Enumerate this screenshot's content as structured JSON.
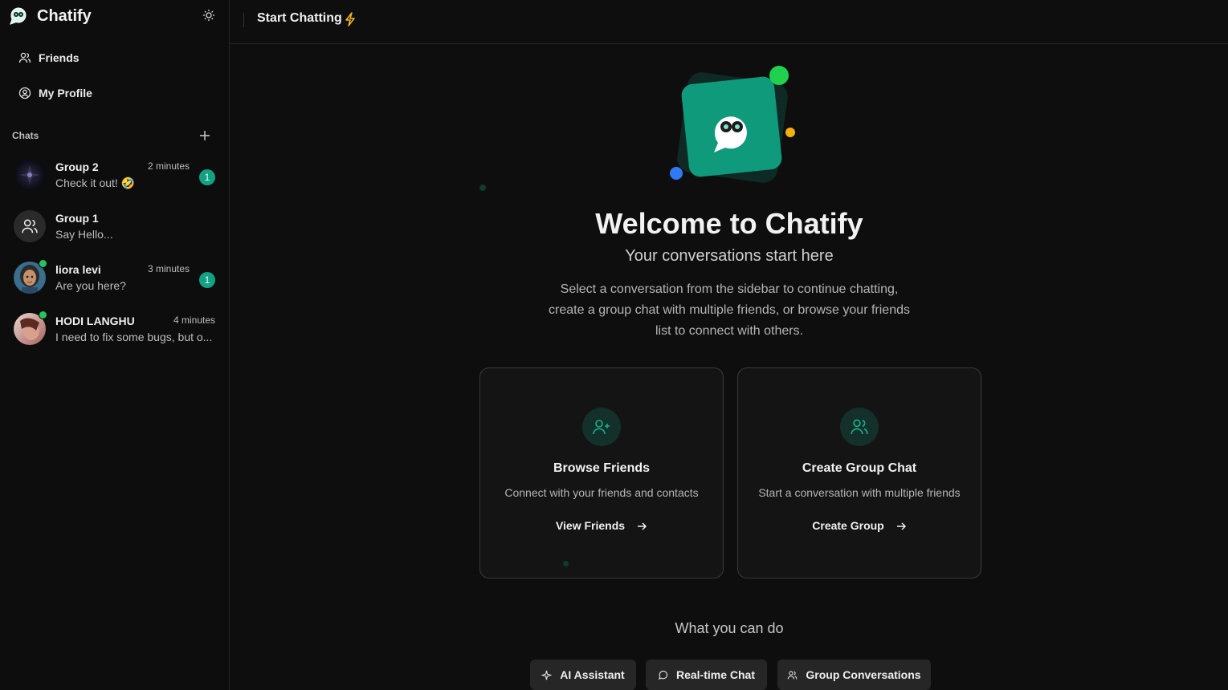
{
  "app": {
    "name": "Chatify"
  },
  "sidebar": {
    "nav": [
      {
        "label": "Friends",
        "icon": "users-icon"
      },
      {
        "label": "My Profile",
        "icon": "user-circle-icon"
      }
    ],
    "chats_label": "Chats",
    "chats": [
      {
        "name": "Group 2",
        "message": "Check it out! 🤣",
        "time": "2 minutes",
        "unread": "1",
        "online": false
      },
      {
        "name": "Group 1",
        "message": "Say Hello...",
        "time": "",
        "unread": "",
        "online": false
      },
      {
        "name": "liora levi",
        "message": "Are you here?",
        "time": "3 minutes",
        "unread": "1",
        "online": true
      },
      {
        "name": "HODI LANGHU",
        "message": "I need to fix some bugs, but o...",
        "time": "4 minutes",
        "unread": "",
        "online": true
      }
    ]
  },
  "header": {
    "title": "Start Chatting"
  },
  "main": {
    "welcome": "Welcome to Chatify",
    "subtitle": "Your conversations start here",
    "description": "Select a conversation from the sidebar to continue chatting, create a group chat with multiple friends, or browse your friends list to connect with others.",
    "cards": [
      {
        "title": "Browse Friends",
        "description": "Connect with your friends and contacts",
        "link": "View Friends",
        "icon": "user-plus-icon"
      },
      {
        "title": "Create Group Chat",
        "description": "Start a conversation with multiple friends",
        "link": "Create Group",
        "icon": "users-icon"
      }
    ],
    "features_heading": "What you can do",
    "features": [
      {
        "label": "AI Assistant",
        "icon": "sparkles-icon"
      },
      {
        "label": "Real-time Chat",
        "icon": "message-circle-icon"
      },
      {
        "label": "Group Conversations",
        "icon": "users-icon"
      }
    ]
  },
  "colors": {
    "accent": "#12a182",
    "background": "#0e0e0e",
    "online": "#22c55e"
  }
}
